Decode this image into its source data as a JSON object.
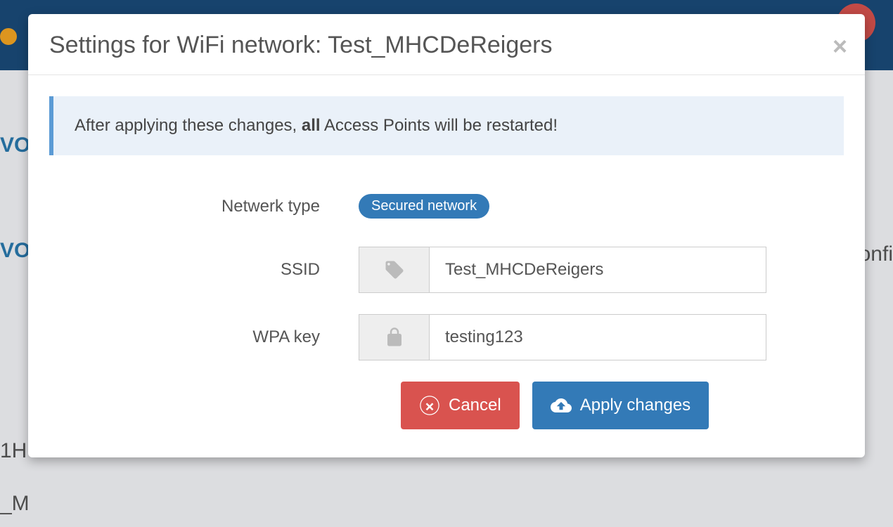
{
  "background": {
    "label1": "VO",
    "label2": "VO",
    "label3": "1H",
    "label4": "_M",
    "label5": "onfi"
  },
  "modal": {
    "title": "Settings for WiFi network: Test_MHCDeReigers",
    "alert_pre": "After applying these changes, ",
    "alert_bold": "all",
    "alert_post": " Access Points will be restarted!"
  },
  "form": {
    "network_type_label": "Netwerk type",
    "network_type_badge": "Secured network",
    "ssid_label": "SSID",
    "ssid_value": "Test_MHCDeReigers",
    "wpa_label": "WPA key",
    "wpa_value": "testing123"
  },
  "buttons": {
    "cancel": "Cancel",
    "apply": "Apply changes"
  }
}
